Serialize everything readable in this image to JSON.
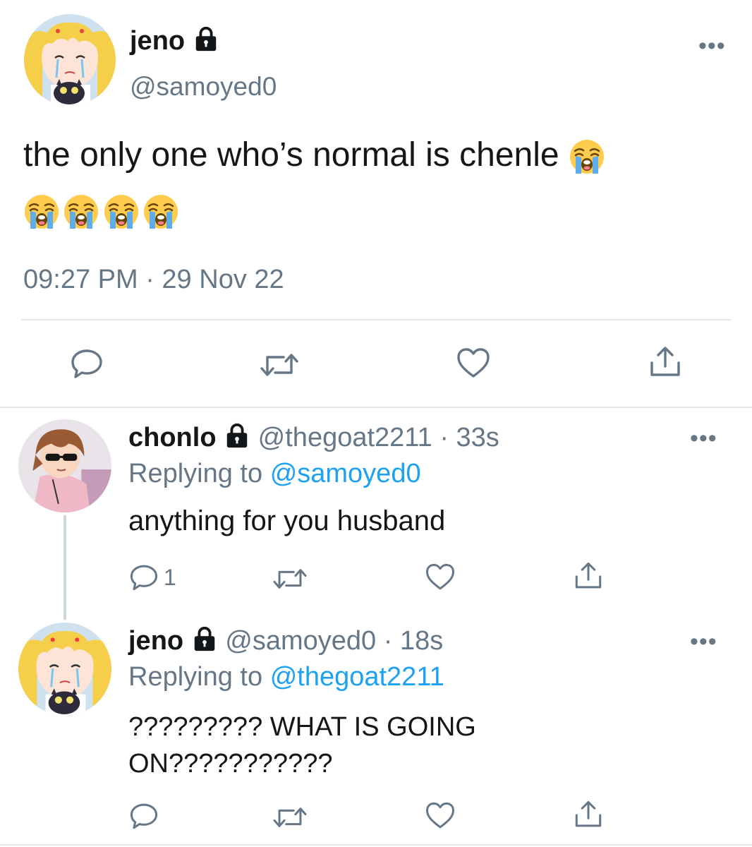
{
  "main_tweet": {
    "display_name": "jeno",
    "handle": "@samoyed0",
    "text": "the only one who’s normal is chenle",
    "emoji_name": "loudly-crying-face",
    "emoji_count": 5,
    "timestamp": "09:27 PM · 29 Nov 22",
    "more_label": "•••"
  },
  "replies": [
    {
      "display_name": "chonlo",
      "handle": "@thegoat2211",
      "separator": "·",
      "time": "33s",
      "replying_prefix": "Replying to",
      "replying_to": "@samoyed0",
      "text": "anything for you husband",
      "reply_count": "1",
      "more_label": "•••"
    },
    {
      "display_name": "jeno",
      "handle": "@samoyed0",
      "separator": "·",
      "time": "18s",
      "replying_prefix": "Replying to",
      "replying_to": "@thegoat2211",
      "text_line1": "????????? WHAT IS GOING",
      "text_line2": "ON???????????",
      "more_label": "•••"
    }
  ],
  "icons": {
    "lock": "lock-icon",
    "reply": "reply-icon",
    "retweet": "retweet-icon",
    "like": "heart-icon",
    "share": "share-icon",
    "more": "more-icon"
  },
  "colors": {
    "text": "#14171a",
    "muted": "#657786",
    "link": "#1da1f2",
    "divider": "#e1e8ed"
  }
}
